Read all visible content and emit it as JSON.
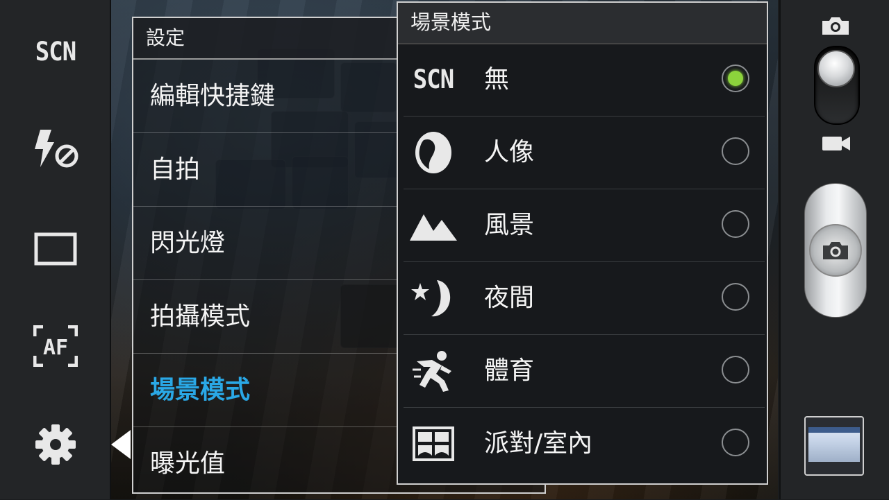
{
  "left_rail": {
    "scene_shortcut_label": "SCN",
    "af_label": "AF"
  },
  "settings": {
    "title": "設定",
    "items": [
      {
        "label": "編輯快捷鍵"
      },
      {
        "label": "自拍"
      },
      {
        "label": "閃光燈"
      },
      {
        "label": "拍攝模式"
      },
      {
        "label": "場景模式",
        "active": true
      },
      {
        "label": "曝光值"
      }
    ]
  },
  "scene_popup": {
    "title": "場景模式",
    "options": [
      {
        "label": "無",
        "icon": "scn-icon",
        "icon_text": "SCN",
        "selected": true
      },
      {
        "label": "人像",
        "icon": "portrait-icon",
        "selected": false
      },
      {
        "label": "風景",
        "icon": "landscape-icon",
        "selected": false
      },
      {
        "label": "夜間",
        "icon": "night-icon",
        "selected": false
      },
      {
        "label": "體育",
        "icon": "sports-icon",
        "selected": false
      },
      {
        "label": "派對/室內",
        "icon": "party-indoor-icon",
        "selected": false
      }
    ]
  },
  "colors": {
    "active_accent": "#2aa8e6",
    "radio_selected": "#8cd33c"
  }
}
